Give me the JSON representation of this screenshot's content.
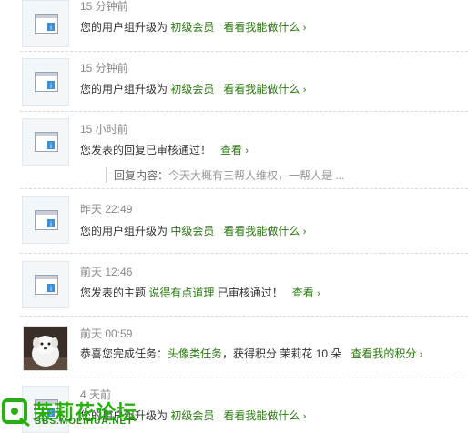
{
  "feed": {
    "items": [
      {
        "time": "15 分钟前",
        "pre": "您的用户组升级为 ",
        "highlight": "初级会员",
        "link": "看看我能做什么",
        "chev": "›"
      },
      {
        "time": "15 分钟前",
        "pre": "您的用户组升级为 ",
        "highlight": "初级会员",
        "link": "看看我能做什么",
        "chev": "›"
      },
      {
        "time": "15 小时前",
        "pre": "您发表的回复已审核通过！",
        "highlight": "",
        "link": "查看",
        "chev": "›",
        "quote_label": "回复内容：",
        "quote_value": "今天大概有三帮人维权，一帮人是 ..."
      },
      {
        "time": "昨天 22:49",
        "pre": "您的用户组升级为 ",
        "highlight": "中级会员",
        "link": "看看我能做什么",
        "chev": "›"
      },
      {
        "time": "前天 12:46",
        "pre": "您发表的主题 ",
        "highlight": "说得有点道理",
        "post": " 已审核通过！",
        "link": "查看",
        "chev": "›"
      },
      {
        "time": "前天 00:59",
        "pre": "恭喜您完成任务：",
        "highlight": "头像类任务",
        "post": "，获得积分 茉莉花 10 朵",
        "link": "查看我的积分",
        "chev": "›"
      },
      {
        "time": "4 天前",
        "pre": "您的用户组升级为 ",
        "highlight": "初级会员",
        "link": "看看我能做什么",
        "chev": "›"
      }
    ]
  },
  "watermark": {
    "title": "茉莉花论坛",
    "url": "BBS.MOLIHUA.NET"
  },
  "colors": {
    "accent": "#2a7a0f",
    "logo_green": "#27b00f",
    "time_gray": "#888888"
  }
}
